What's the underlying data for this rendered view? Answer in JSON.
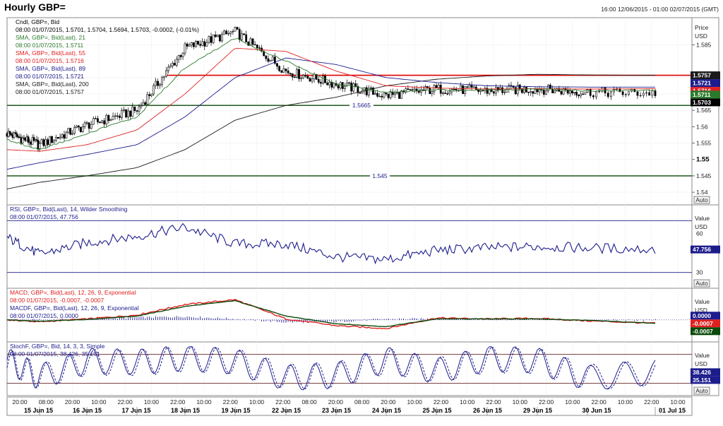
{
  "window": {
    "title": "Hourly GBP=",
    "range": "16:00 12/06/2015 - 01:00 02/07/2015 (GMT)",
    "auto_label": "Auto"
  },
  "colors": {
    "price": "#000000",
    "sma21": "#2b7a2b",
    "sma55": "#e02020",
    "sma89": "#1c1c8c",
    "sma200": "#1a1a1a",
    "resistance": "#e00000",
    "support": "#0a4a0a",
    "rsi": "#1c1c8c",
    "macd": "#e02020",
    "macdf": "#0a4a0a",
    "hist": "#1c1c8c",
    "stoch_k": "#1c1c8c",
    "stoch_d": "#1c1c8c"
  },
  "price_panel": {
    "legend": [
      {
        "text": "Cndl, GBP=, Bid",
        "color": "#000000"
      },
      {
        "text": "08:00 01/07/2015, 1.5701, 1.5704, 1.5694, 1.5703, -0.0002, (-0.01%)",
        "color": "#000000"
      },
      {
        "text": "SMA, GBP=, Bid(Last), 21",
        "color": "#2b7a2b"
      },
      {
        "text": "08:00 01/07/2015, 1.5711",
        "color": "#2b7a2b"
      },
      {
        "text": "SMA, GBP=, Bid(Last), 55",
        "color": "#e02020"
      },
      {
        "text": "08:00 01/07/2015, 1.5716",
        "color": "#e02020"
      },
      {
        "text": "SMA, GBP=, Bid(Last), 89",
        "color": "#1c1c8c"
      },
      {
        "text": "08:00 01/07/2015, 1.5721",
        "color": "#1c1c8c"
      },
      {
        "text": "SMA, GBP=, Bid(Last), 200",
        "color": "#1a1a1a"
      },
      {
        "text": "08:00 01/07/2015, 1.5757",
        "color": "#1a1a1a"
      }
    ],
    "axis_title_1": "Price",
    "axis_title_2": "USD",
    "ticks": [
      "1.585",
      "1.575",
      "1.57",
      "1.565",
      "1.56",
      "1.555",
      "1.55",
      "1.545",
      "1.54"
    ],
    "bold_tick": "1.55",
    "hline_support_label": "1.5665",
    "hline_low_label": "1.545",
    "badges": [
      {
        "value": "1.5757",
        "bg": "#1a1a1a",
        "fg": "#ffffff"
      },
      {
        "value": "1.5721",
        "bg": "#1c1c8c",
        "fg": "#ffffff"
      },
      {
        "value": "1.5716",
        "bg": "#e02020",
        "fg": "#ffffff"
      },
      {
        "value": "1.5711",
        "bg": "#2b7a2b",
        "fg": "#ffffff"
      },
      {
        "value": "1.5703",
        "bg": "#000000",
        "fg": "#ffffff"
      }
    ]
  },
  "rsi_panel": {
    "legend": [
      {
        "text": "RSI, GBP=, Bid(Last), 14, Wilder Smoothing",
        "color": "#1c1c8c"
      },
      {
        "text": "08:00 01/07/2015, 47.756",
        "color": "#1c1c8c"
      }
    ],
    "axis_title_1": "Value",
    "axis_title_2": "USD",
    "ticks": [
      "60",
      "30"
    ],
    "badge": "47.756"
  },
  "macd_panel": {
    "legend": [
      {
        "text": "MACD, GBP=, Bid(Last), 12, 26, 9, Exponential",
        "color": "#e02020"
      },
      {
        "text": "08:00 01/07/2015, -0.0007, -0.0007",
        "color": "#e02020"
      },
      {
        "text": "MACDF, GBP=, Bid(Last), 12, 26, 9, Exponential",
        "color": "#1c1c8c"
      },
      {
        "text": "08:00 01/07/2015, 0.0000",
        "color": "#1c1c8c"
      }
    ],
    "axis_title_1": "Value",
    "axis_title_2": "USD",
    "badges": [
      {
        "value": "0.0000",
        "bg": "#1c1c8c",
        "fg": "#ffffff"
      },
      {
        "value": "-0.0007",
        "bg": "#e02020",
        "fg": "#ffffff"
      },
      {
        "value": "-0.0007",
        "bg": "#0a4a0a",
        "fg": "#ffffff"
      }
    ]
  },
  "stoch_panel": {
    "legend": [
      {
        "text": "StochF, GBP=, Bid, 14, 3, 3, Simple",
        "color": "#1c1c8c"
      },
      {
        "text": "08:00 01/07/2015, 38.426, 35.151",
        "color": "#1c1c8c"
      }
    ],
    "axis_title_1": "Value",
    "axis_title_2": "USD",
    "badges": [
      {
        "value": "38.426",
        "bg": "#1c1c8c",
        "fg": "#ffffff"
      },
      {
        "value": "35.151",
        "bg": "#1c1c8c",
        "fg": "#ffffff"
      }
    ]
  },
  "x_axis": {
    "time_labels": [
      "20:00",
      "08:00",
      "20:00",
      "10:00",
      "22:00",
      "10:00",
      "22:00",
      "10:00",
      "22:00",
      "10:00",
      "22:00",
      "08:00",
      "20:00",
      "08:00",
      "20:00",
      "10:00",
      "22:00",
      "10:00",
      "22:00",
      "10:00",
      "22:00",
      "10:00",
      "22:00",
      "10:00",
      "22:00",
      "10:00"
    ],
    "dates": [
      "15 Jun 15",
      "16 Jun 15",
      "17 Jun 15",
      "18 Jun 15",
      "19 Jun 15",
      "22 Jun 15",
      "23 Jun 15",
      "24 Jun 15",
      "25 Jun 15",
      "26 Jun 15",
      "29 Jun 15",
      "30 Jun 15",
      "01 Jul 15"
    ]
  },
  "chart_data": [
    {
      "type": "candlestick",
      "title": "Hourly GBP=",
      "ylabel": "Price USD",
      "ylim": [
        1.537,
        1.592
      ],
      "x": [
        "12 Jun 15",
        "15 Jun 15",
        "16 Jun 15",
        "17 Jun 15",
        "18 Jun 15",
        "19 Jun 15",
        "22 Jun 15",
        "23 Jun 15",
        "24 Jun 15",
        "25 Jun 15",
        "26 Jun 15",
        "29 Jun 15",
        "30 Jun 15",
        "01 Jul 15"
      ],
      "close_path": [
        1.558,
        1.5545,
        1.5605,
        1.565,
        1.584,
        1.589,
        1.577,
        1.573,
        1.5695,
        1.5715,
        1.571,
        1.5715,
        1.5705,
        1.5703
      ],
      "sma21": [
        1.556,
        1.553,
        1.558,
        1.563,
        1.578,
        1.587,
        1.58,
        1.573,
        1.5705,
        1.5712,
        1.5712,
        1.5714,
        1.571,
        1.5711
      ],
      "sma55": [
        1.553,
        1.5525,
        1.5545,
        1.559,
        1.57,
        1.584,
        1.583,
        1.577,
        1.5725,
        1.5718,
        1.5715,
        1.5716,
        1.5715,
        1.5716
      ],
      "sma89": [
        1.547,
        1.549,
        1.5515,
        1.5545,
        1.563,
        1.575,
        1.581,
        1.579,
        1.575,
        1.5735,
        1.5725,
        1.5722,
        1.5721,
        1.5721
      ],
      "sma200": [
        1.541,
        1.543,
        1.545,
        1.5475,
        1.553,
        1.562,
        1.5665,
        1.569,
        1.5725,
        1.5745,
        1.5755,
        1.576,
        1.5758,
        1.5757
      ],
      "horizontal_lines": [
        {
          "value": 1.5757,
          "label": ""
        },
        {
          "value": 1.5665,
          "label": "1.5665"
        },
        {
          "value": 1.545,
          "label": "1.545"
        }
      ],
      "last": {
        "open": 1.5701,
        "high": 1.5704,
        "low": 1.5694,
        "close": 1.5703
      }
    },
    {
      "type": "line",
      "title": "RSI, GBP=, Bid(Last), 14, Wilder Smoothing",
      "ylim": [
        20,
        80
      ],
      "reference_lines": [
        70,
        30
      ],
      "values": [
        57,
        44,
        53,
        58,
        65,
        52,
        52,
        42,
        40,
        47,
        49,
        50,
        49,
        47.756
      ]
    },
    {
      "type": "line",
      "title": "MACD, GBP=, Bid(Last), 12, 26, 9, Exponential",
      "ylim": [
        -0.004,
        0.006
      ],
      "series": [
        {
          "name": "MACD",
          "values": [
            0.0,
            -0.0004,
            0.0002,
            0.001,
            0.0032,
            0.0042,
            0.0002,
            -0.0012,
            -0.0018,
            0.0004,
            0.0002,
            0.0003,
            -0.0002,
            -0.0007
          ]
        },
        {
          "name": "Signal",
          "values": [
            0.0,
            -0.0003,
            0.0001,
            0.0008,
            0.0028,
            0.004,
            0.0008,
            -0.0008,
            -0.0014,
            0.0002,
            0.0002,
            0.0002,
            -0.0001,
            -0.0007
          ]
        },
        {
          "name": "MACDF",
          "values": [
            0.0,
            0.0,
            0.0002,
            0.0005,
            0.0007,
            0.0002,
            -0.0005,
            -0.0004,
            0.0002,
            0.0002,
            0.0001,
            0.0001,
            -0.0001,
            0.0
          ]
        }
      ]
    },
    {
      "type": "line",
      "title": "StochF, GBP=, Bid, 14, 3, 3, Simple",
      "ylim": [
        0,
        100
      ],
      "reference_lines": [
        80,
        20
      ],
      "series": [
        {
          "name": "%K",
          "values": [
            85,
            15,
            82,
            78,
            95,
            80,
            12,
            22,
            88,
            40,
            92,
            85,
            10,
            38.426
          ]
        },
        {
          "name": "%D",
          "values": [
            80,
            18,
            78,
            74,
            92,
            82,
            16,
            25,
            82,
            44,
            88,
            82,
            14,
            35.151
          ]
        }
      ]
    }
  ]
}
